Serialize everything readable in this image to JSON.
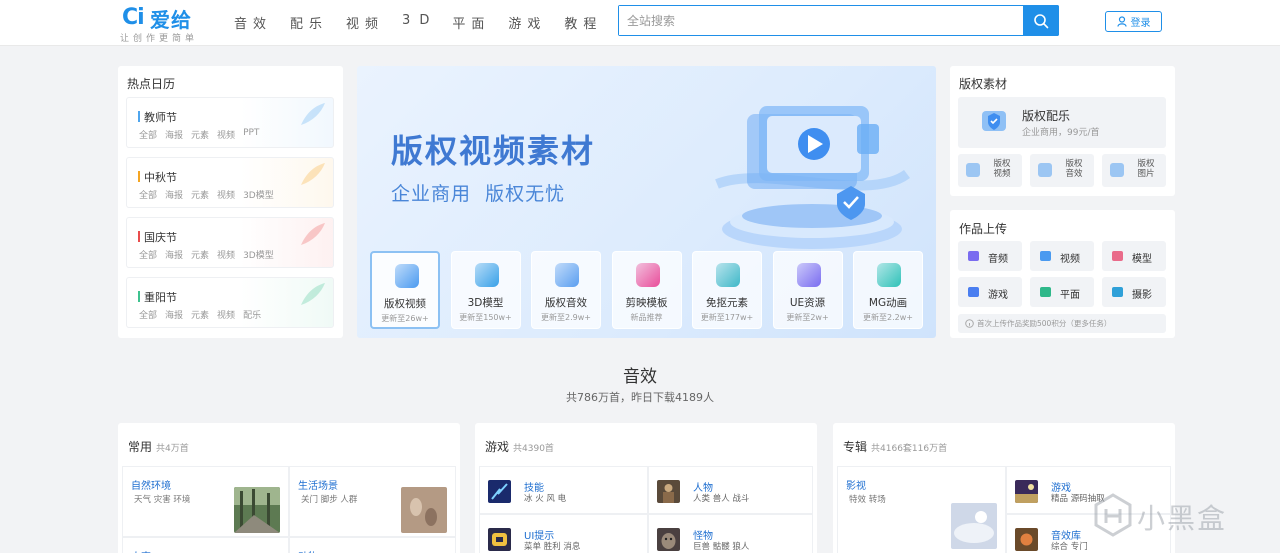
{
  "header": {
    "logo": {
      "mark": "Ci",
      "name": "爱给",
      "slogan": "让创作更简单"
    },
    "nav": [
      "音效",
      "配乐",
      "视频",
      "3D",
      "平面",
      "游戏",
      "教程"
    ],
    "search": {
      "placeholder": "全站搜索",
      "value": ""
    },
    "login_label": "登录"
  },
  "hot_calendar": {
    "title": "热点日历",
    "items": [
      {
        "name": "教师节",
        "color": "#4fa6ee",
        "tags": [
          "全部",
          "海报",
          "元素",
          "视频",
          "PPT"
        ]
      },
      {
        "name": "中秋节",
        "color": "#f5a623",
        "tags": [
          "全部",
          "海报",
          "元素",
          "视频",
          "3D模型"
        ]
      },
      {
        "name": "国庆节",
        "color": "#e94d4d",
        "tags": [
          "全部",
          "海报",
          "元素",
          "视频",
          "3D模型"
        ]
      },
      {
        "name": "重阳节",
        "color": "#3ec28f",
        "tags": [
          "全部",
          "海报",
          "元素",
          "视频",
          "配乐"
        ]
      }
    ]
  },
  "banner": {
    "title": "版权视频素材",
    "subtitle": "企业商用  版权无忧",
    "categories": [
      {
        "name": "版权视频",
        "update": "更新至26w+",
        "color": "#4a9af0",
        "active": true
      },
      {
        "name": "3D模型",
        "update": "更新至150w+",
        "color": "#38a0e8",
        "active": false
      },
      {
        "name": "版权音效",
        "update": "更新至2.9w+",
        "color": "#5a9ef0",
        "active": false
      },
      {
        "name": "剪映模板",
        "update": "新品推荐",
        "color": "#e94d9a",
        "active": false
      },
      {
        "name": "免抠元素",
        "update": "更新至177w+",
        "color": "#3fb8c8",
        "active": false
      },
      {
        "name": "UE资源",
        "update": "更新至2w+",
        "color": "#7a6cf0",
        "active": false
      },
      {
        "name": "MG动画",
        "update": "更新至2.2w+",
        "color": "#2fc2b8",
        "active": false
      }
    ]
  },
  "copyright": {
    "title": "版权素材",
    "main": {
      "title": "版权配乐",
      "subtitle": "企业商用，99元/首"
    },
    "items": [
      "版权视频",
      "版权音效",
      "版权图片"
    ]
  },
  "upload": {
    "title": "作品上传",
    "items": [
      {
        "name": "音频",
        "color": "#7a6cf0"
      },
      {
        "name": "视频",
        "color": "#4a9af0"
      },
      {
        "name": "模型",
        "color": "#e96b8a"
      },
      {
        "name": "游戏",
        "color": "#4a7ef0"
      },
      {
        "name": "平面",
        "color": "#2fb88a"
      },
      {
        "name": "摄影",
        "color": "#2fa0d8"
      }
    ],
    "note": "首次上传作品奖励500积分（更多任务）"
  },
  "section": {
    "title": "音效",
    "subtitle": "共786万首，昨日下载4189人"
  },
  "columns": {
    "common": {
      "title": "常用",
      "count": "共4万首",
      "cells": [
        {
          "title": "自然环境",
          "desc": "天气 灾害 环境"
        },
        {
          "title": "生活场景",
          "desc": "关门 脚步 人群"
        },
        {
          "title": "人声",
          "desc": ""
        },
        {
          "title": "动物",
          "desc": ""
        }
      ]
    },
    "games": {
      "title": "游戏",
      "count": "共4390首",
      "cells": [
        {
          "title": "技能",
          "desc": "冰 火 风 电"
        },
        {
          "title": "人物",
          "desc": "人类 兽人 战斗"
        },
        {
          "title": "UI提示",
          "desc": "菜单 胜利 消息"
        },
        {
          "title": "怪物",
          "desc": "巨兽 骷髅 狼人"
        }
      ]
    },
    "albums": {
      "title": "专辑",
      "count": "共4166套116万首",
      "cells": [
        {
          "title": "影视",
          "desc": "特效 转场"
        },
        {
          "title": "游戏",
          "desc": "精品 源码抽取"
        },
        {
          "title": "音效库",
          "desc": "综合 专门"
        }
      ]
    }
  },
  "watermark": "小黑盒"
}
